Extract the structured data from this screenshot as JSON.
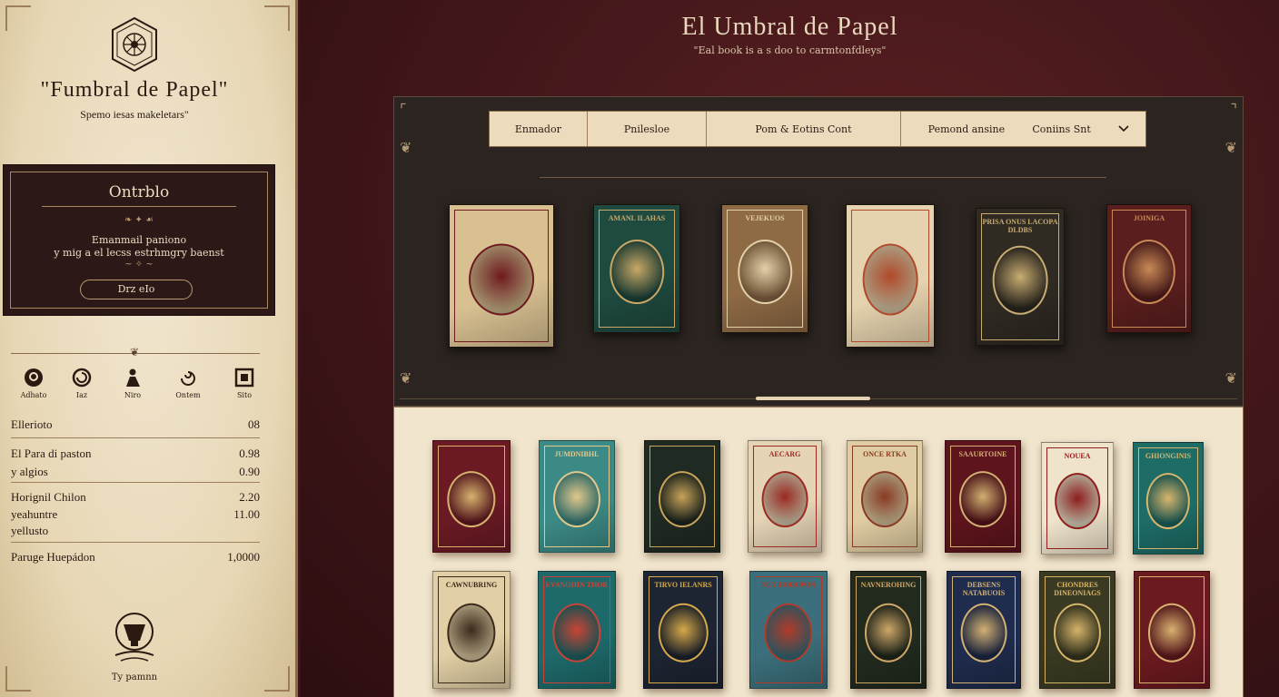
{
  "brand": {
    "title": "\"Fumbral de Papel\"",
    "tagline": "Spemo iesas makeletars\""
  },
  "promo": {
    "title": "Ontrblo",
    "line1": "Emanmail paniono",
    "line2": "y mig a el lecss estrhmgry baenst",
    "button": "Drz eIo"
  },
  "nav_icons": [
    {
      "label": "Adhato",
      "icon": "coin-icon"
    },
    {
      "label": "Iaz",
      "icon": "spiral-icon"
    },
    {
      "label": "Niro",
      "icon": "figure-icon"
    },
    {
      "label": "Ontem",
      "icon": "swirl-icon"
    },
    {
      "label": "Sito",
      "icon": "frame-icon"
    }
  ],
  "stats": [
    {
      "label": "Ellerioto",
      "value": "08"
    },
    {
      "label": "El Para di paston",
      "value": "0.98"
    },
    {
      "label": "y algios",
      "value": "0.90"
    },
    {
      "label": "Horignil Chilon",
      "value": "2.20"
    },
    {
      "label": "yeahuntre",
      "value": "11.00"
    },
    {
      "label": "yellusto",
      "value": ""
    },
    {
      "label": "Paruge Huepádon",
      "value": "1,0000"
    }
  ],
  "footer_label": "Ty pamnn",
  "main": {
    "title": "El Umbral de Papel",
    "subtitle": "\"Eal book is a s doo to carmtonfdleys\""
  },
  "filters": [
    "Enmador",
    "Pnilesloe",
    "Pom & Eotins Cont",
    "Pemond ansine",
    "Coniins Snt"
  ],
  "featured_books": [
    {
      "title": "",
      "bg": "#d8c091",
      "accent": "#6e1a1e"
    },
    {
      "title": "AMANL ILAHAS",
      "bg": "#1f4a3f",
      "accent": "#c9a867"
    },
    {
      "title": "VEJEKUOS",
      "bg": "#8e6a45",
      "accent": "#e3d0a8"
    },
    {
      "title": "",
      "bg": "#e5d2ae",
      "accent": "#b04a2a"
    },
    {
      "title": "PRISA ONUS LACOPA DLDBS",
      "bg": "#2f2a22",
      "accent": "#c9ad72"
    },
    {
      "title": "JOINIGA",
      "bg": "#5a1e1e",
      "accent": "#c98a55"
    }
  ],
  "grid_books": [
    {
      "title": "",
      "bg": "#6b1a24",
      "accent": "#d7b36e"
    },
    {
      "title": "JUMDNIBHL",
      "bg": "#3c8a85",
      "accent": "#e2c88d"
    },
    {
      "title": "",
      "bg": "#1f2a22",
      "accent": "#c9a35a"
    },
    {
      "title": "AECARG",
      "bg": "#e5d4b6",
      "accent": "#9b2a22"
    },
    {
      "title": "ONCE RTKA",
      "bg": "#e1cda3",
      "accent": "#8a3a24"
    },
    {
      "title": "SAAURTOINE",
      "bg": "#5e141c",
      "accent": "#d2b072"
    },
    {
      "title": "NOUEA",
      "bg": "#efe3cb",
      "accent": "#8e1e1e"
    },
    {
      "title": "GHIONGINIS",
      "bg": "#1e6c66",
      "accent": "#d9b66e"
    },
    {
      "title": "CAWNUBRING",
      "bg": "#e2cfa5",
      "accent": "#3b2a1c"
    },
    {
      "title": "EVANOHIN THOR",
      "bg": "#1e6a6b",
      "accent": "#c94436"
    },
    {
      "title": "TIRVO IELANRS",
      "bg": "#1d2432",
      "accent": "#d6a94a"
    },
    {
      "title": "NEY HODUPON",
      "bg": "#3b6f7b",
      "accent": "#b23a2a"
    },
    {
      "title": "NAVNEROHING",
      "bg": "#222a1e",
      "accent": "#cfa868"
    },
    {
      "title": "DEBSENS NATABUOIS",
      "bg": "#1f2c4d",
      "accent": "#d3b174"
    },
    {
      "title": "CHONDRES DINEONIAGS",
      "bg": "#3a3a22",
      "accent": "#d6b56a"
    },
    {
      "title": "",
      "bg": "#6b1a20",
      "accent": "#d9b270"
    }
  ]
}
